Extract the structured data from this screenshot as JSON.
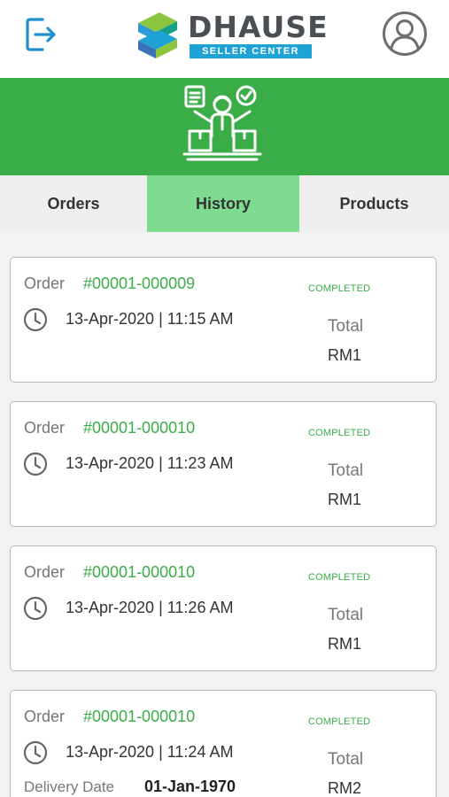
{
  "header": {
    "logo_name": "DHAUSE",
    "logo_sub": "SELLER CENTER",
    "logout_icon": "logout-icon",
    "profile_icon": "user-profile-icon"
  },
  "banner": {
    "icon": "seller-with-parcels-icon"
  },
  "tabs": [
    {
      "label": "Orders",
      "active": false
    },
    {
      "label": "History",
      "active": true
    },
    {
      "label": "Products",
      "active": false
    }
  ],
  "colors": {
    "brand_green": "#3aad48",
    "active_tab": "#7ddc8f",
    "logo_blue": "#1fa2d6",
    "status_green": "#3aad48"
  },
  "orders": [
    {
      "order_label": "Order",
      "order_no": "#00001-000009",
      "datetime": "13-Apr-2020 | 11:15 AM",
      "status": "COMPLETED",
      "total_label": "Total",
      "total": "RM1"
    },
    {
      "order_label": "Order",
      "order_no": "#00001-000010",
      "datetime": "13-Apr-2020 | 11:23 AM",
      "status": "COMPLETED",
      "total_label": "Total",
      "total": "RM1"
    },
    {
      "order_label": "Order",
      "order_no": "#00001-000010",
      "datetime": "13-Apr-2020 | 11:26 AM",
      "status": "COMPLETED",
      "total_label": "Total",
      "total": "RM1"
    },
    {
      "order_label": "Order",
      "order_no": "#00001-000010",
      "datetime": "13-Apr-2020 | 11:24 AM",
      "status": "COMPLETED",
      "total_label": "Total",
      "total": "RM2",
      "delivery_label": "Delivery Date",
      "delivery_date": "01-Jan-1970"
    }
  ]
}
